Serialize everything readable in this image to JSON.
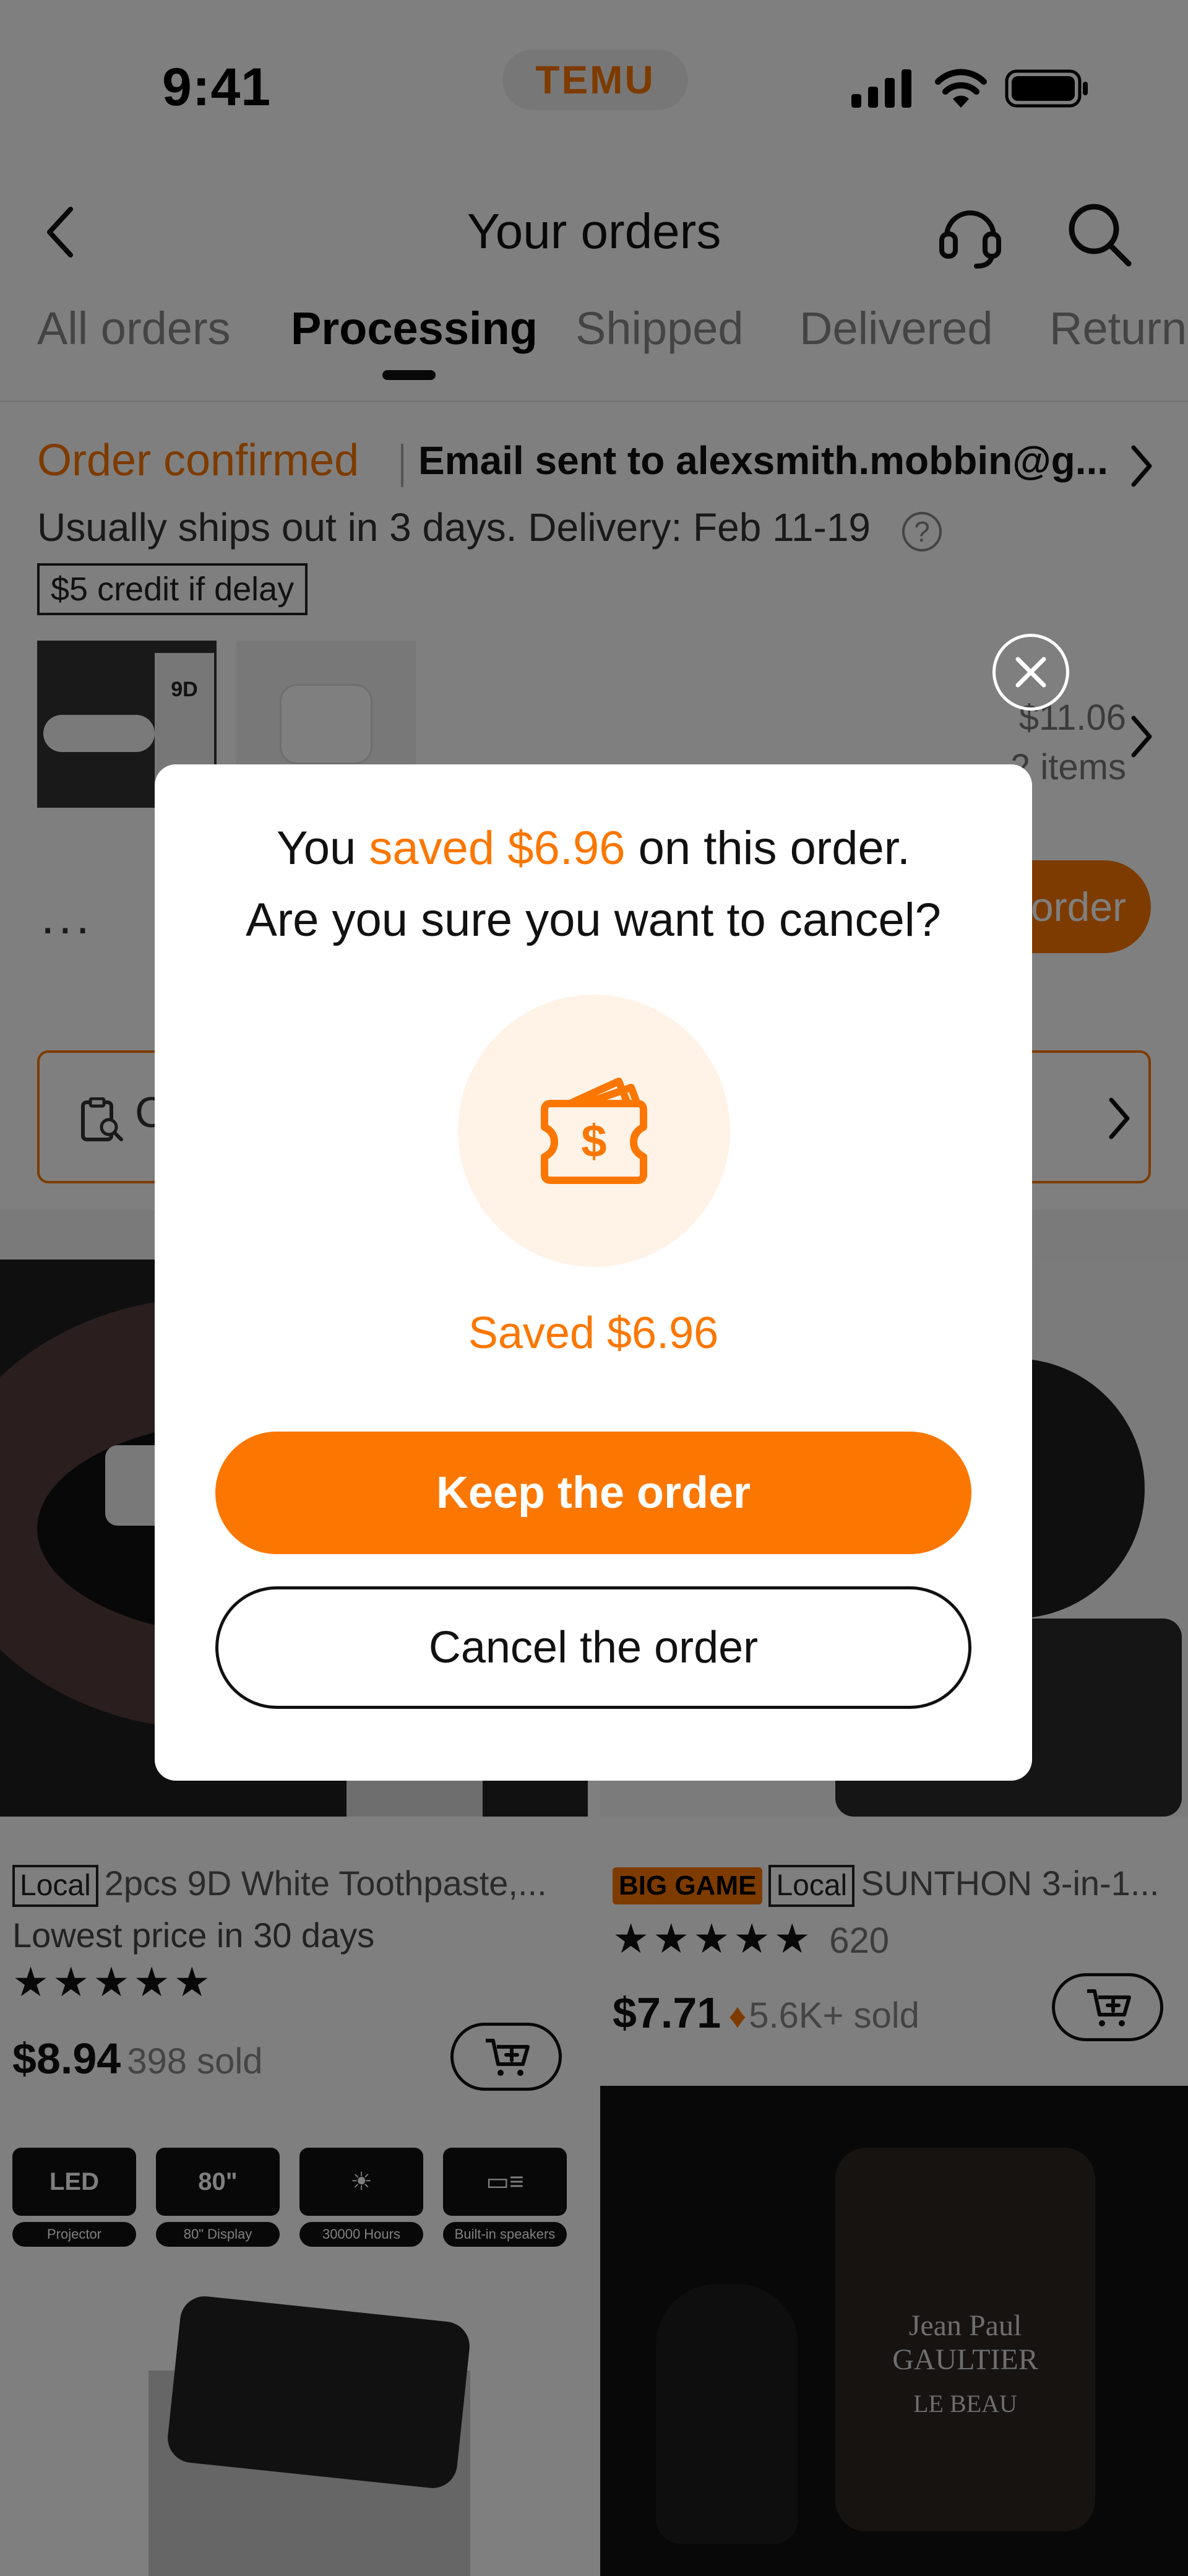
{
  "status_bar": {
    "time": "9:41",
    "brand": "TEMU"
  },
  "header": {
    "title": "Your orders",
    "back_icon": "chevron-left-icon",
    "support_icon": "headset-icon",
    "search_icon": "search-icon"
  },
  "tabs": [
    {
      "label": "All orders",
      "active": false
    },
    {
      "label": "Processing",
      "active": true
    },
    {
      "label": "Shipped",
      "active": false
    },
    {
      "label": "Delivered",
      "active": false
    },
    {
      "label": "Return",
      "active": false
    }
  ],
  "order": {
    "status": "Order confirmed",
    "email_note": "Email sent to alexsmith.mobbin@g...",
    "shipping_note": "Usually ships out in 3 days. Delivery: Feb 11-19",
    "credit_badge": "$5 credit if delay",
    "thumb_text": "9D",
    "total_amount": "$11.06",
    "item_count": "2 items",
    "more_label": "...",
    "action_button": "order",
    "address_label": "C"
  },
  "products": [
    {
      "tags": [
        "Local"
      ],
      "name": "2pcs 9D White Toothpaste,...",
      "subtitle": "Lowest price in 30 days",
      "stars": "★★★★★",
      "price_symbol": "$",
      "price": "8.94",
      "sold": "398 sold"
    },
    {
      "promo": "BIG GAME",
      "tags": [
        "Local"
      ],
      "name": "SUNTHON 3-in-1...",
      "stars": "★★★★★",
      "review_count": "620",
      "price_symbol": "$",
      "price": "7.71",
      "sold": "5.6K+ sold"
    },
    {
      "features": [
        {
          "icon": "LED",
          "label": "Projector"
        },
        {
          "icon": "80\"",
          "label": "80\" Display"
        },
        {
          "icon": "☀",
          "label": "30000 Hours"
        },
        {
          "icon": "▭≡",
          "label": "Built-in speakers"
        }
      ]
    },
    {
      "brand_text": "Jean Paul GAULTIER",
      "brand_sub": "LE BEAU"
    }
  ],
  "modal": {
    "line1_prefix": "You ",
    "line1_highlight": "saved $6.96",
    "line1_suffix": " on this order.",
    "line2": "Are you sure you want to cancel?",
    "saved_label": "Saved $6.96",
    "keep_button": "Keep the order",
    "cancel_button": "Cancel the order",
    "wallet_icon": "wallet-dollar-icon",
    "close_icon": "close-icon"
  },
  "colors": {
    "accent": "#fb7701",
    "accent_soft": "#fff3e8",
    "overlay": "rgba(0,0,0,0.5)"
  }
}
